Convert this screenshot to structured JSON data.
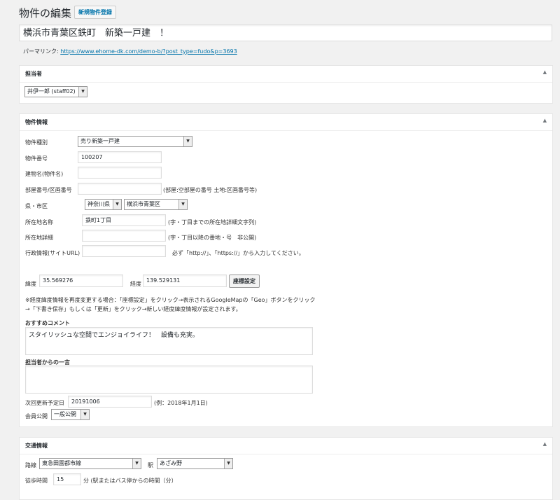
{
  "header": {
    "page_title": "物件の編集",
    "add_new_label": "新規物件登録",
    "post_title": "横浜市青葉区鉄町　新築一戸建　！",
    "permalink_label": "パーマリンク:",
    "permalink_url": "https://www.ehome-dk.com/demo-b/?post_type=fudo&p=3693"
  },
  "agent_box": {
    "title": "担当者",
    "toggle": "▲",
    "agent_select": "井伊一郎 (staff02)"
  },
  "property_box": {
    "title": "物件情報",
    "toggle": "▲",
    "type_label": "物件種別",
    "type_value": "売り新築一戸建",
    "number_label": "物件番号",
    "number_value": "100207",
    "building_label": "建物名(物件名)",
    "building_value": "",
    "room_label": "部屋番号/区画番号",
    "room_value": "",
    "room_hint": "(部屋:空部屋の番号 土地:区画番号等)",
    "pref_city_label": "県・市区",
    "pref_value": "神奈川県",
    "city_value": "横浜市青葉区",
    "address_label": "所在地名称",
    "address_value": "鉄町1丁目",
    "address_hint": "(字・丁目までの所在地詳細文字列)",
    "address_detail_label": "所在地詳細",
    "address_detail_value": "",
    "address_detail_hint": "(字・丁目以降の番地・号　非公開)",
    "gov_url_label": "行政情報(サイトURL)",
    "gov_url_value": "",
    "gov_url_hint": "必ず「http://」、「https://」から入力してください。",
    "lat_label": "緯度",
    "lat_value": "35.569276",
    "lng_label": "経度",
    "lng_value": "139.529131",
    "coord_button": "座標設定",
    "coord_note_1": "※経度緯度情報を再度変更する場合：「座標設定」をクリック→表示されるGoogleMapの「Geo」ボタンをクリック",
    "coord_note_2": "→「下書き保存」もしくは「更新」をクリック→新しい経度緯度情報が設定されます。",
    "recommend_label": "おすすめコメント",
    "recommend_value": "スタイリッシュな空間でエンジョイライフ！　設備も充実。",
    "staff_comment_label": "担当者からの一言",
    "staff_comment_value": "",
    "next_update_label": "次回更新予定日",
    "next_update_value": "20191006",
    "next_update_hint": "(例：2018年1月1日)",
    "member_label": "会員公開",
    "member_value": "一般公開"
  },
  "transport_box": {
    "title": "交通情報",
    "toggle": "▲",
    "line_label": "路線",
    "line_value": "東急田園都市線",
    "station_label": "駅",
    "station_value": "あざみ野",
    "walk_label": "徒歩時間",
    "walk_value": "15",
    "walk_hint": "分 (駅またはバス停からの時間（分）"
  }
}
